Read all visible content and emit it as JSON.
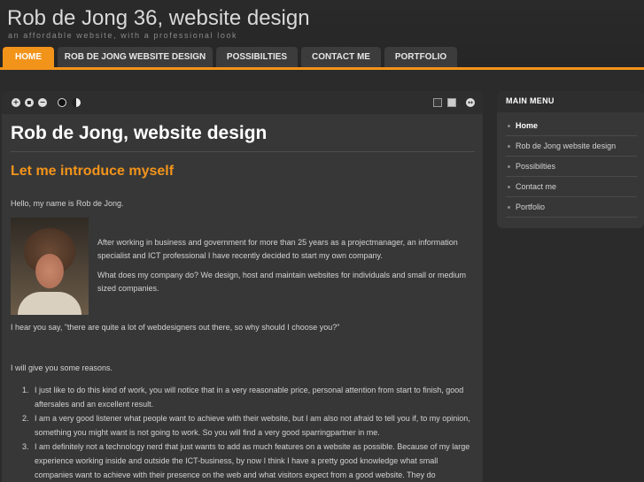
{
  "site": {
    "title": "Rob de Jong 36, website design",
    "tagline": "an affordable website, with a professional look"
  },
  "nav": {
    "tabs": [
      {
        "label": "HOME",
        "active": true
      },
      {
        "label": "ROB DE JONG WEBSITE DESIGN",
        "active": false
      },
      {
        "label": "POSSIBILTIES",
        "active": false
      },
      {
        "label": "CONTACT ME",
        "active": false
      },
      {
        "label": "PORTFOLIO",
        "active": false
      }
    ]
  },
  "toolbar": {
    "icons": [
      "increase-font-icon",
      "reset-font-icon",
      "decrease-font-icon",
      "dark-theme-icon",
      "light-theme-icon",
      "narrow-layout-icon",
      "wide-layout-icon",
      "expand-icon"
    ]
  },
  "article": {
    "title": "Rob de Jong, website design",
    "heading": "Let me introduce myself",
    "greeting": "Hello, my name is Rob de Jong.",
    "para1": "After working in business and government for more than 25 years as a projectmanager, an information specialist and ICT professional I have recently decided to start my own company.",
    "para2": "What does my company do? We design, host and maintain websites for individuals and small or medium sized companies.",
    "hear": "I hear you say, \"there are quite a lot of webdesigners out there, so why should I choose you?\"",
    "reasons_intro": "I will give you some reasons.",
    "reasons": [
      {
        "num": "1.",
        "text": "I just like to do this kind of work, you will notice that in a very reasonable price, personal attention from start to finish, good aftersales and an excellent result."
      },
      {
        "num": "2.",
        "text": "I am a very good listener what people want to achieve with their website, but I am also not afraid to tell you if, to my opinion, something you might want is not going to work. So you will find a very good sparringpartner in me."
      },
      {
        "num": "3.",
        "text": "I am definitely not a technology nerd that just wants to add as much features on a website as possible. Because of my large experience working inside and outside the ICT-business, by now I think I have a pretty good knowledge what small companies want to achieve with their presence on the web and what visitors expect from a good website. They do"
      }
    ]
  },
  "sidebar": {
    "title": "MAIN MENU",
    "items": [
      {
        "label": "Home",
        "active": true
      },
      {
        "label": "Rob de Jong website design",
        "active": false
      },
      {
        "label": "Possibilties",
        "active": false
      },
      {
        "label": "Contact me",
        "active": false
      },
      {
        "label": "Portfolio",
        "active": false
      }
    ]
  },
  "colors": {
    "accent": "#f3941a",
    "background": "#2b2b2b",
    "panel": "#373737"
  }
}
